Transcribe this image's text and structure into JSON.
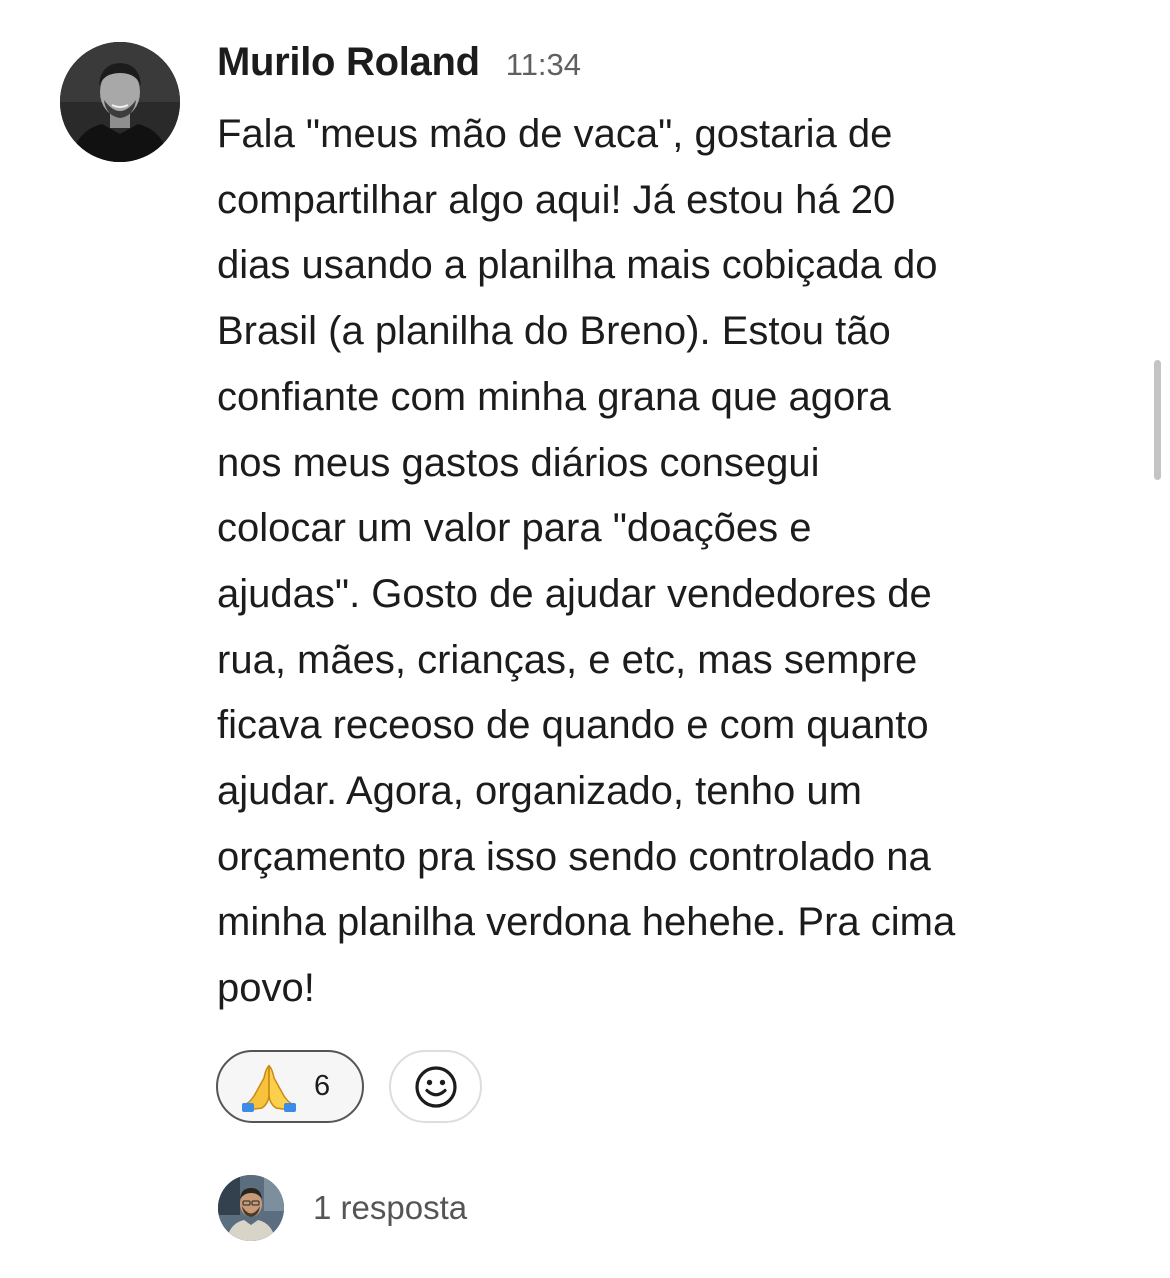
{
  "message": {
    "author": "Murilo Roland",
    "time": "11:34",
    "avatar_icon": "user-photo-avatar",
    "lines": [
      "Fala \"meus mão de vaca\", gostaria de",
      "compartilhar algo aqui! Já estou há 20",
      "dias usando a planilha mais cobiçada do",
      "Brasil (a planilha do Breno). Estou tão",
      "confiante com minha grana que agora",
      "nos meus gastos diários consegui",
      "colocar um valor para \"doações e",
      "ajudas\". Gosto de ajudar vendedores de",
      "rua, mães, crianças, e etc, mas sempre",
      "ficava receoso de quando e com quanto",
      "ajudar. Agora, organizado, tenho um",
      "orçamento pra isso sendo controlado na",
      "minha planilha verdona hehehe. Pra cima",
      "povo!"
    ]
  },
  "reactions": [
    {
      "emoji_icon": "folded-hands-icon",
      "count": "6"
    }
  ],
  "add_reaction": {
    "icon": "smiley-add-reaction-icon"
  },
  "thread": {
    "replier_avatar_icon": "user-photo-avatar",
    "reply_count": "1 resposta"
  },
  "colors": {
    "text": "#1d1c1d",
    "muted": "#616061",
    "reaction_border": "#555555",
    "scrollbar": "#c4c4c4"
  }
}
